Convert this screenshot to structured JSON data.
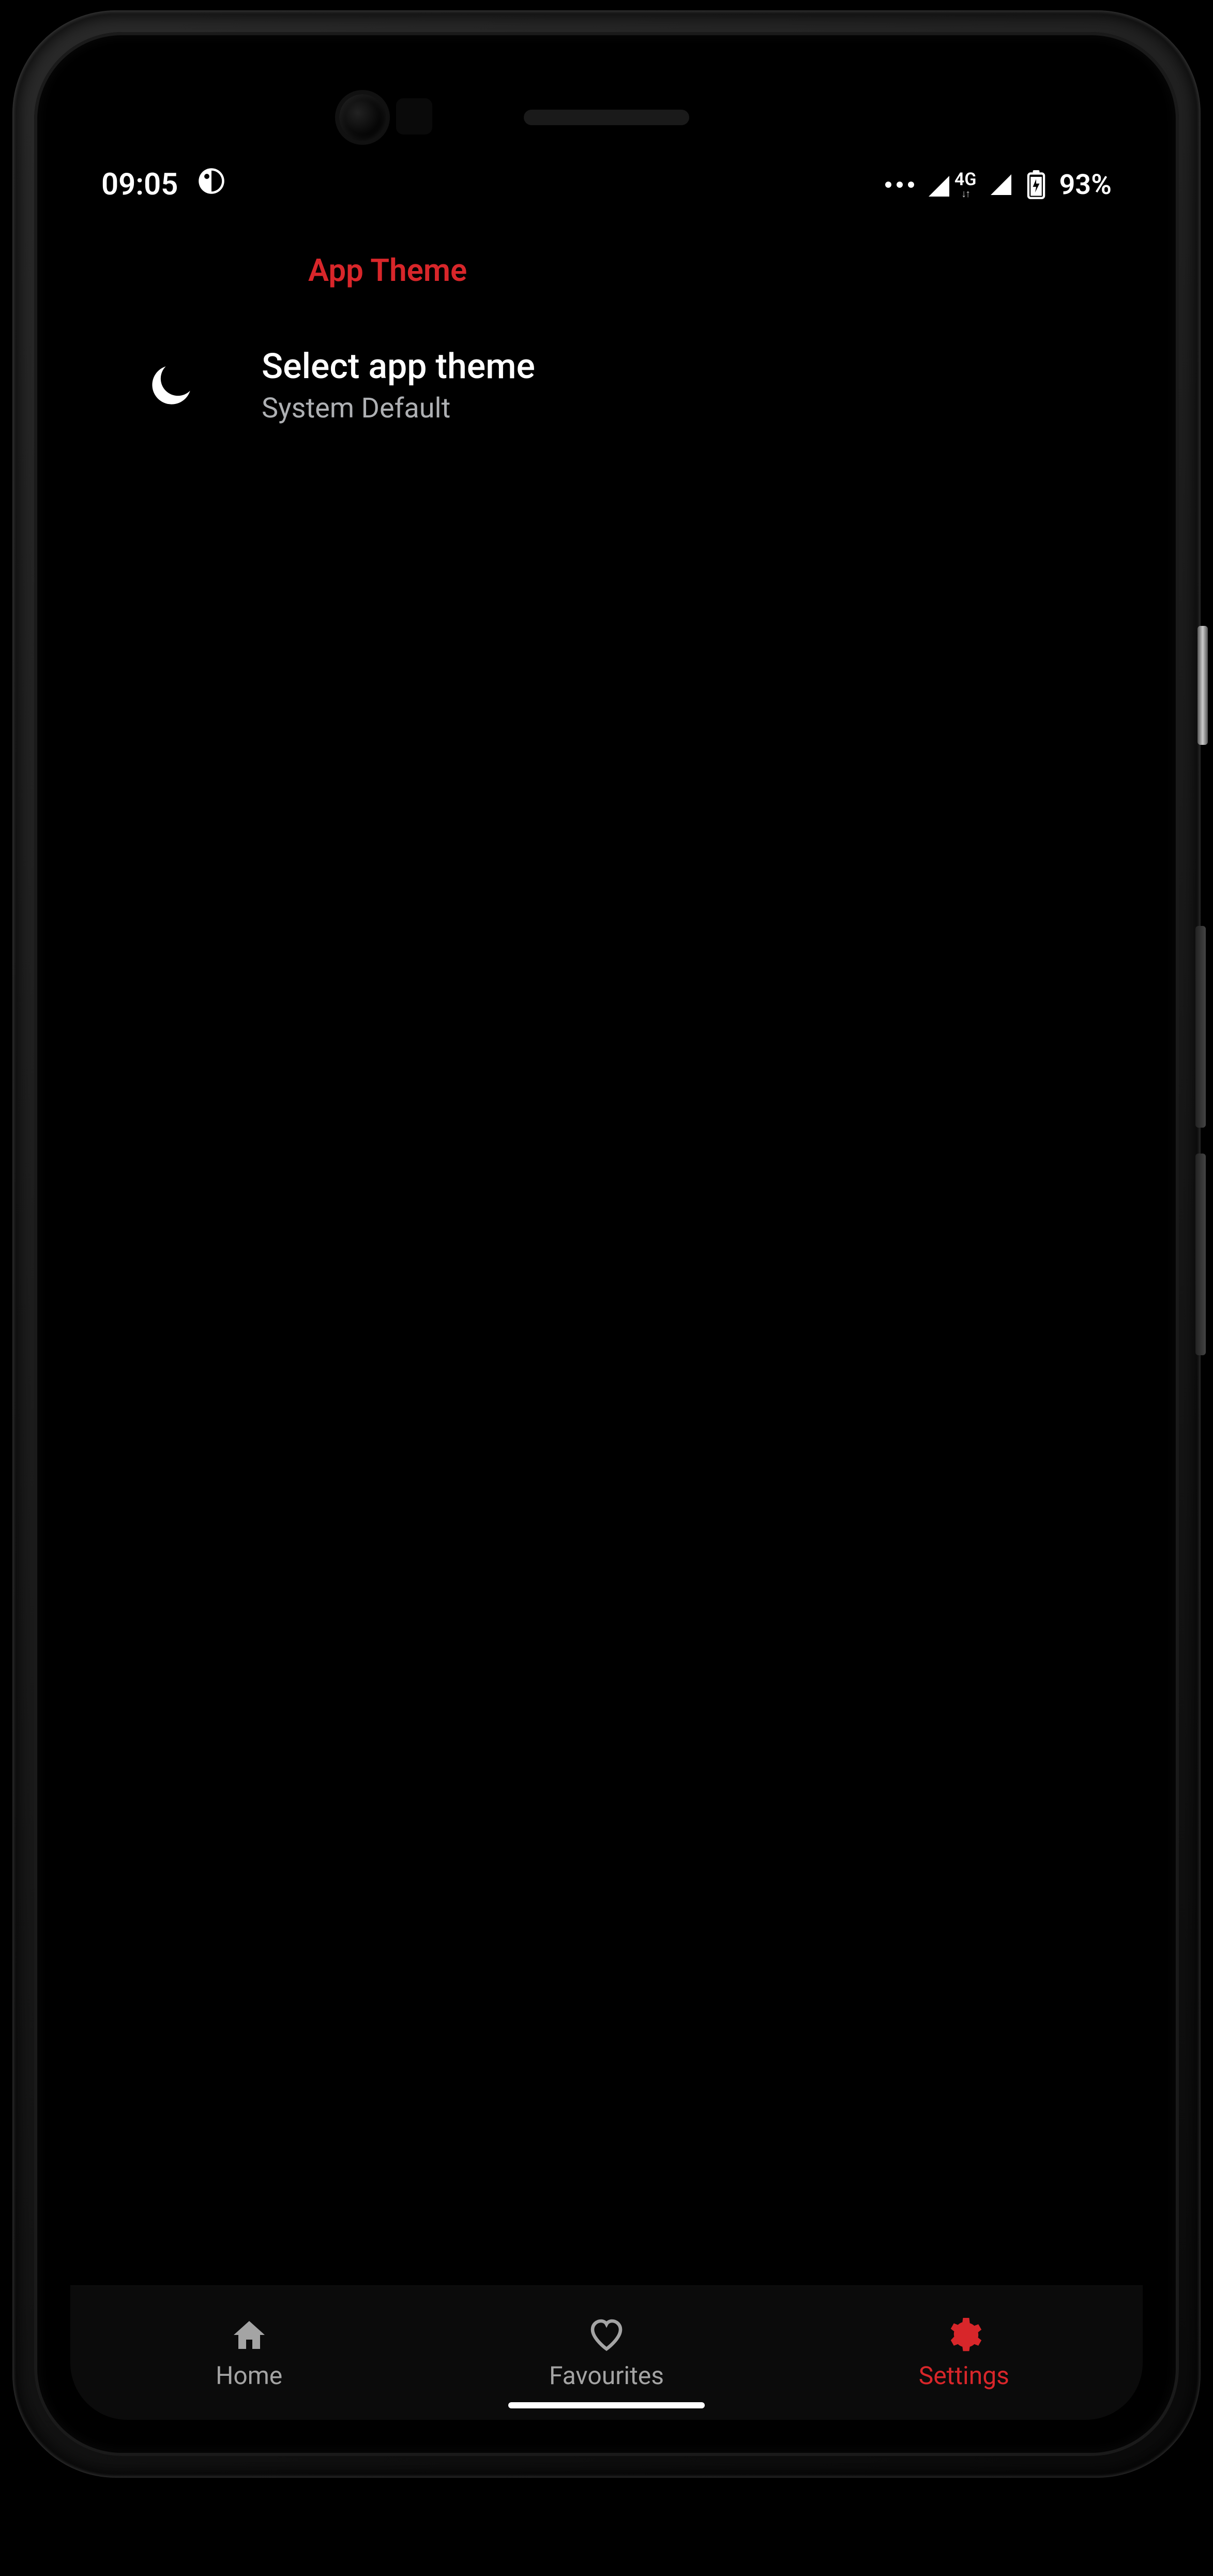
{
  "status": {
    "time": "09:05",
    "network_type": "4G",
    "battery_text": "93%"
  },
  "section": {
    "title": "App Theme"
  },
  "setting": {
    "title": "Select app theme",
    "value": "System Default"
  },
  "nav": {
    "home": "Home",
    "favourites": "Favourites",
    "settings": "Settings"
  },
  "colors": {
    "accent": "#d8262a",
    "muted": "#a4a4a4"
  }
}
